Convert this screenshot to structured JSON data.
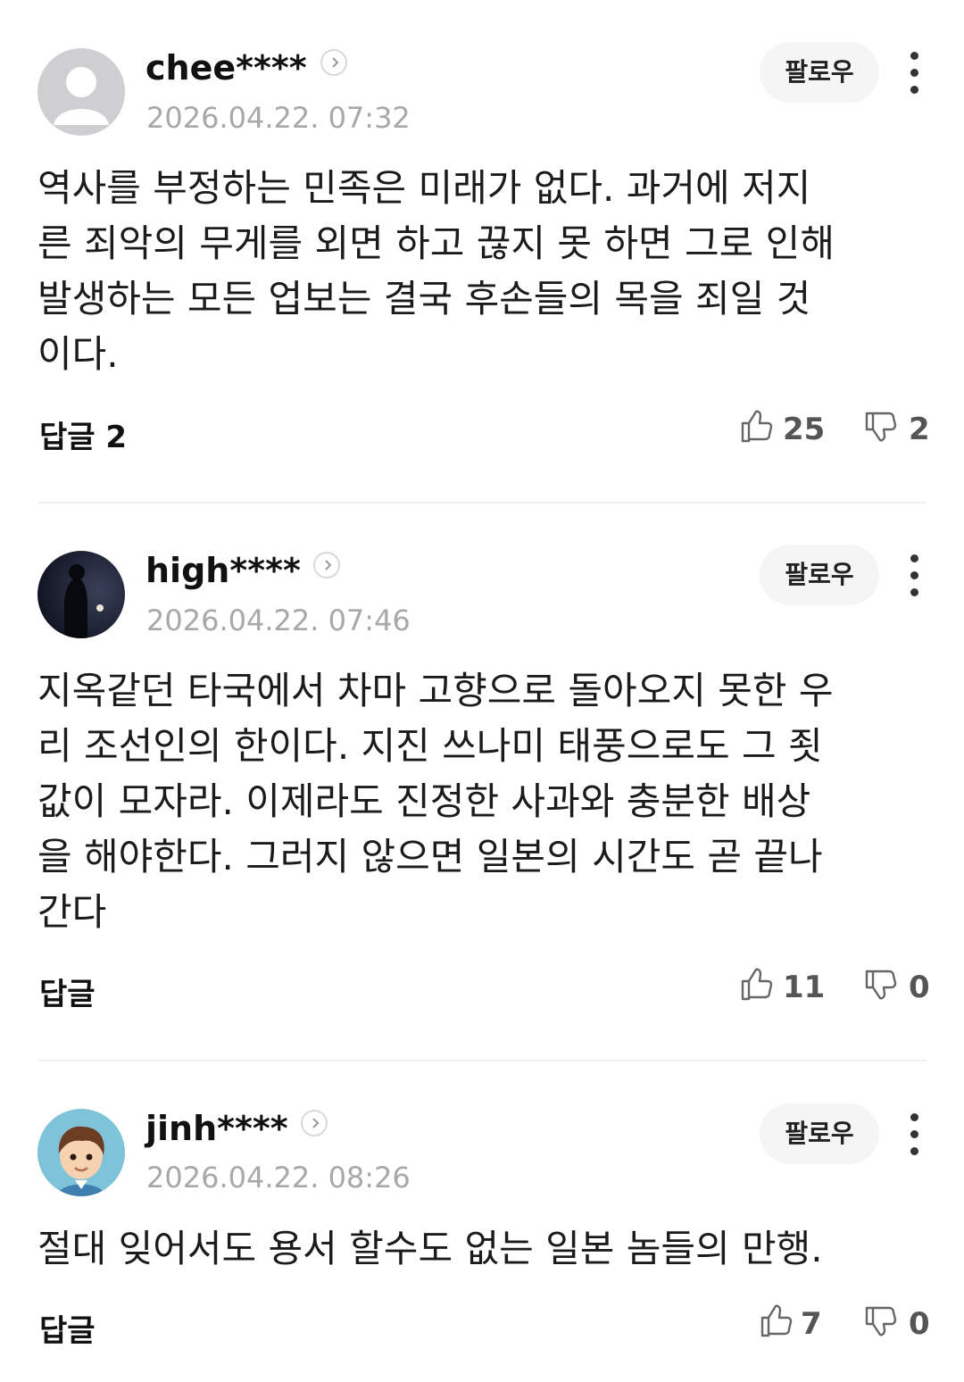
{
  "comments": [
    {
      "username": "chee****",
      "timestamp": "2026.04.22. 07:32",
      "follow_label": "팔로우",
      "text": "역사를 부정하는 민족은 미래가 없다. 과거에 저지\n른 죄악의 무게를 외면 하고 끊지 못 하면 그로 인해\n발생하는 모든 업보는 결국 후손들의 목을 죄일 것\n이다.",
      "reply_label": "답글 2",
      "likes": "25",
      "dislikes": "2"
    },
    {
      "username": "high****",
      "timestamp": "2026.04.22. 07:46",
      "follow_label": "팔로우",
      "text": "지옥같던 타국에서 차마 고향으로 돌아오지 못한 우\n리 조선인의 한이다. 지진 쓰나미 태풍으로도 그 죗\n값이 모자라. 이제라도 진정한 사과와 충분한 배상\n을 해야한다. 그러지 않으면 일본의 시간도 곧 끝나\n간다",
      "reply_label": "답글",
      "likes": "11",
      "dislikes": "0"
    },
    {
      "username": "jinh****",
      "timestamp": "2026.04.22. 08:26",
      "follow_label": "팔로우",
      "text": "절대 잊어서도 용서 할수도 없는 일본 놈들의 만행.",
      "reply_label": "답글",
      "likes": "7",
      "dislikes": "0"
    }
  ],
  "colors": {
    "timestamp": "#a8a8a8",
    "follow_bg": "#f5f5f5",
    "divider": "#f0f0f0"
  }
}
